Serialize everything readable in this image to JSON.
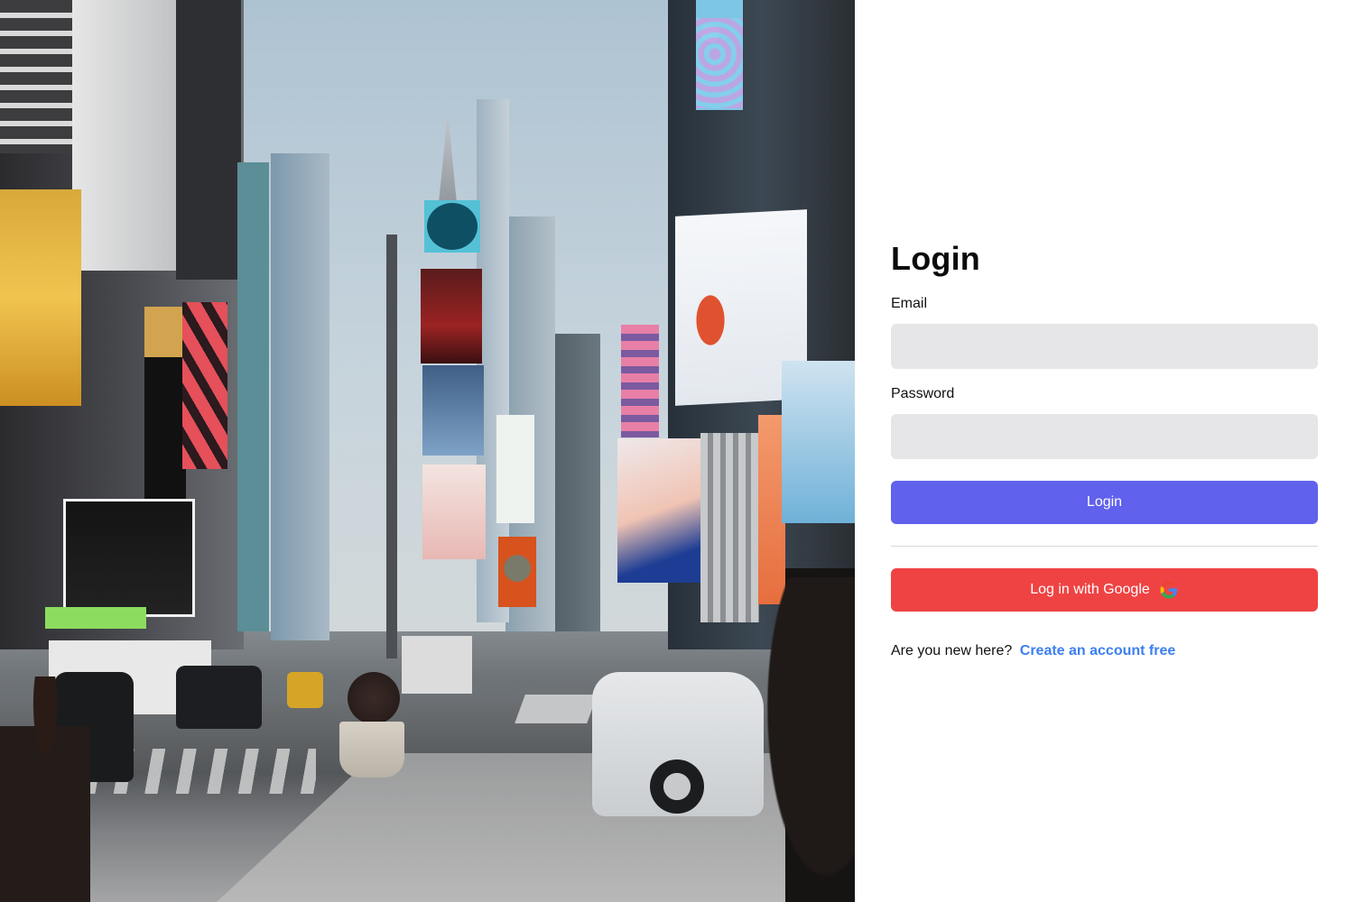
{
  "hero": {
    "icon": "city-street-photo"
  },
  "login": {
    "title": "Login",
    "email": {
      "label": "Email",
      "value": "",
      "placeholder": ""
    },
    "password": {
      "label": "Password",
      "value": "",
      "placeholder": ""
    },
    "submit_label": "Login",
    "google_label": "Log in with Google",
    "google_icon": "google-icon",
    "signup_prompt": "Are you new here?",
    "signup_link": "Create an account free"
  },
  "colors": {
    "primary": "#6061ec",
    "google": "#ef4343",
    "link": "#3b7ff0",
    "input_bg": "#e6e6e9"
  }
}
